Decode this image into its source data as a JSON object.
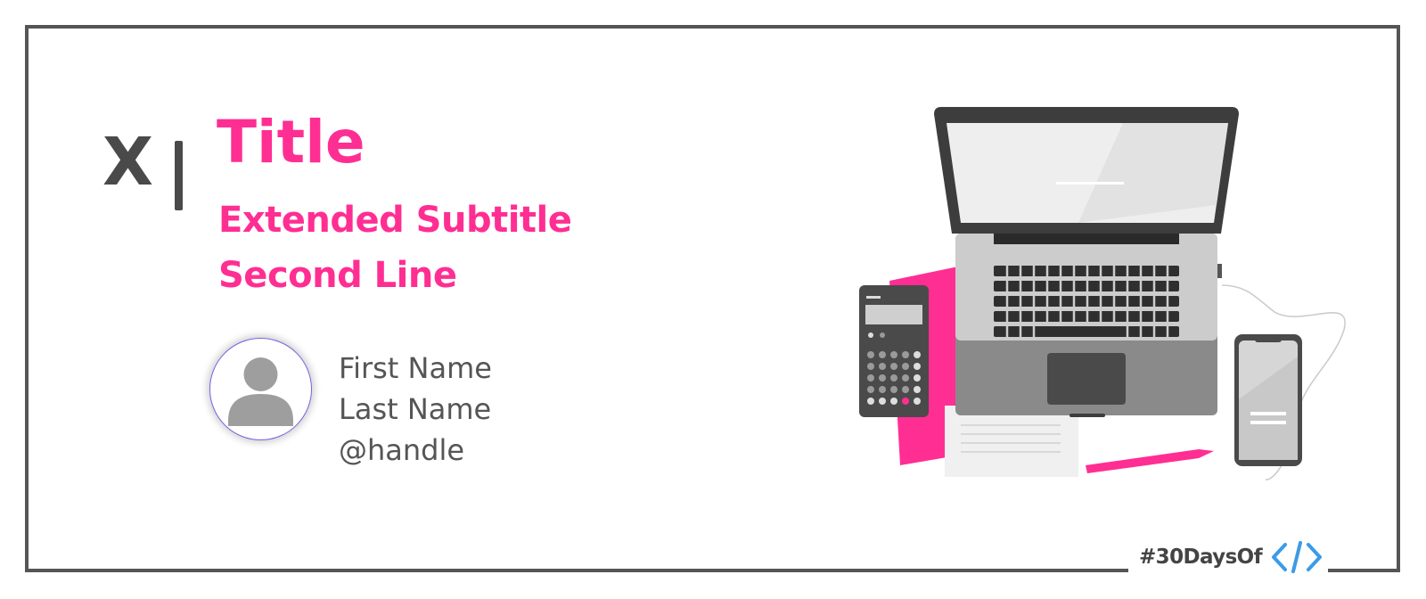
{
  "header": {
    "marker": "X",
    "title": "Title",
    "subtitle_line1": "Extended Subtitle",
    "subtitle_line2": "Second Line"
  },
  "author": {
    "first_name": "First Name",
    "last_name": "Last Name",
    "handle": "@handle"
  },
  "footer": {
    "hashtag": "#30DaysOf",
    "icon": "code-brackets-icon"
  },
  "colors": {
    "accent": "#ff2e93",
    "text_dark": "#4a4a4a",
    "text_body": "#555555",
    "frame": "#555555",
    "code_icon": "#3b9be8"
  },
  "illustration": {
    "icons": [
      "laptop-icon",
      "calculator-icon",
      "smartphone-icon",
      "pen-icon",
      "notepad-icon",
      "folder-icon"
    ]
  }
}
